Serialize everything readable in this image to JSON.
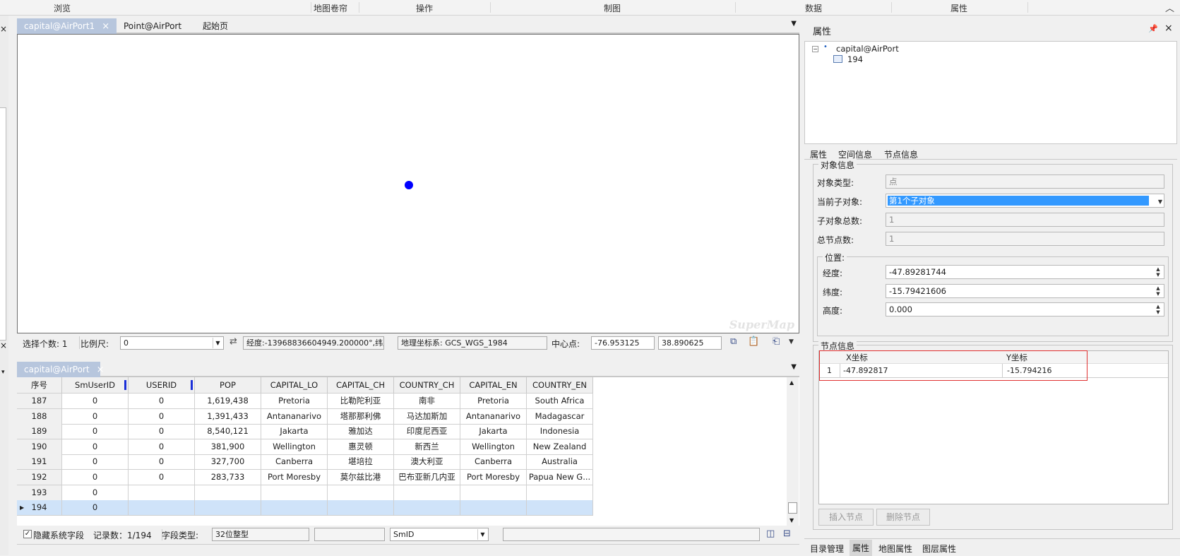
{
  "ribbon": {
    "tabs": [
      "浏览",
      "地图卷帘",
      "操作",
      "制图",
      "数据",
      "属性"
    ]
  },
  "map_tabs": [
    {
      "label": "capital@AirPort1",
      "active": true
    },
    {
      "label": "Point@AirPort",
      "active": false
    },
    {
      "label": "起始页",
      "active": false
    }
  ],
  "map": {
    "watermark": "SuperMap",
    "point_color": "#0000ff"
  },
  "map_status": {
    "selection_count": "选择个数: 1",
    "scale_label": "比例尺:",
    "scale_value": "0",
    "coords": "经度:-13968836604949.200000°,纬度:...",
    "crs": "地理坐标系: GCS_WGS_1984",
    "center_label": "中心点:",
    "center_x": "-76.953125",
    "center_y": "38.890625"
  },
  "table_tab": {
    "label": "capital@AirPort"
  },
  "table": {
    "columns": [
      "序号",
      "SmUserID",
      "USERID",
      "POP",
      "CAPITAL_LO",
      "CAPITAL_CH",
      "COUNTRY_CH",
      "CAPITAL_EN",
      "COUNTRY_EN"
    ],
    "rows": [
      [
        "187",
        "0",
        "0",
        "1,619,438",
        "Pretoria",
        "比勒陀利亚",
        "南非",
        "Pretoria",
        "South Africa"
      ],
      [
        "188",
        "0",
        "0",
        "1,391,433",
        "Antananarivo",
        "塔那那利佛",
        "马达加斯加",
        "Antananarivo",
        "Madagascar"
      ],
      [
        "189",
        "0",
        "0",
        "8,540,121",
        "Jakarta",
        "雅加达",
        "印度尼西亚",
        "Jakarta",
        "Indonesia"
      ],
      [
        "190",
        "0",
        "0",
        "381,900",
        "Wellington",
        "惠灵顿",
        "新西兰",
        "Wellington",
        "New Zealand"
      ],
      [
        "191",
        "0",
        "0",
        "327,700",
        "Canberra",
        "堪培拉",
        "澳大利亚",
        "Canberra",
        "Australia"
      ],
      [
        "192",
        "0",
        "0",
        "283,733",
        "Port Moresby",
        "莫尔兹比港",
        "巴布亚新几内亚",
        "Port Moresby",
        "Papua New G..."
      ],
      [
        "193",
        "0",
        "",
        "",
        "",
        "",
        "",
        "",
        ""
      ],
      [
        "194",
        "0",
        "",
        "",
        "",
        "",
        "",
        "",
        ""
      ]
    ],
    "selected_row": "194"
  },
  "table_status": {
    "hide_system_fields": "隐藏系统字段",
    "record_count": "记录数：1/194",
    "field_type_label": "字段类型:",
    "field_type_value": "32位整型",
    "field_select": "SmID"
  },
  "props": {
    "title": "属性",
    "tree_root": "capital@AirPort",
    "tree_child": "194",
    "tabs": [
      "属性",
      "空间信息",
      "节点信息"
    ],
    "object_info_title": "对象信息",
    "object_type_label": "对象类型:",
    "object_type_value": "点",
    "current_sub_label": "当前子对象:",
    "current_sub_value": "第1个子对象",
    "sub_total_label": "子对象总数:",
    "sub_total_value": "1",
    "node_total_label": "总节点数:",
    "node_total_value": "1",
    "position_title": "位置:",
    "lon_label": "经度:",
    "lon_value": "-47.89281744",
    "lat_label": "纬度:",
    "lat_value": "-15.79421606",
    "height_label": "高度:",
    "height_value": "0.000",
    "node_info_title": "节点信息",
    "node_headers": [
      "X坐标",
      "Y坐标"
    ],
    "node_row": [
      "1",
      "-47.892817",
      "-15.794216"
    ],
    "insert_btn": "插入节点",
    "delete_btn": "删除节点",
    "bottom_tabs": [
      "目录管理",
      "属性",
      "地图属性",
      "图层属性"
    ]
  }
}
